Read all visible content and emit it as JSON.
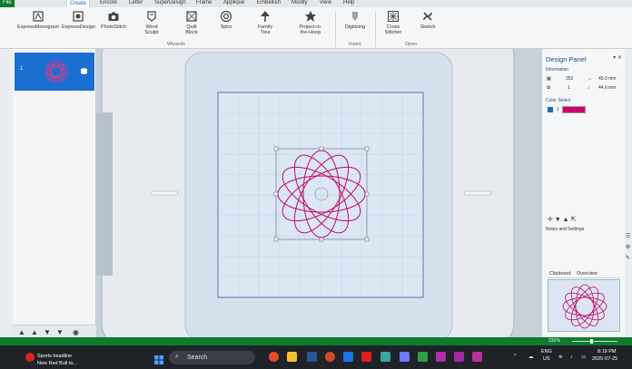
{
  "tabs": [
    "File",
    "Create",
    "Encore",
    "Letter",
    "SuperDesign",
    "Frame",
    "Appliqué",
    "Embellish",
    "Modify",
    "View",
    "Help"
  ],
  "ribbon": {
    "express_monogram": "ExpressMonogram",
    "express_design": "ExpressDesign",
    "photo_stitch": "PhotoStitch",
    "word_sculpt_1": "Word",
    "word_sculpt_2": "Sculpt",
    "quilt_block_1": "Quilt",
    "quilt_block_2": "Block",
    "spiro": "Spiro",
    "family_tree_1": "Family",
    "family_tree_2": "Tree",
    "project_hoop_1": "Project-in-",
    "project_hoop_2": "the-Hoop",
    "digitizing": "Digitizing",
    "cross_stitcher_1": "Cross",
    "cross_stitcher_2": "Stitcher",
    "sketch": "Sketch",
    "group_wizards": "Wizards",
    "group_insert": "Insert",
    "group_open": "Open"
  },
  "design_list": {
    "item_number": "1"
  },
  "design_panel": {
    "title": "Design Panel",
    "information": "Information",
    "stitch_count": "252",
    "width": "45.0 mm",
    "color_count": "1",
    "height": "44.6 mm",
    "color_select": "Color Select",
    "color_index": "1",
    "color_hex": "#d1006b",
    "notes_settings": "Notes and Settings",
    "tab_clipboard": "Clipboard",
    "tab_overview": "Overview"
  },
  "status": {
    "zoom": "231%"
  },
  "taskbar": {
    "news_title": "Sports headline",
    "news_sub": "New Red Bull to...",
    "search": "Search",
    "lang1": "ENG",
    "lang2": "US",
    "time": "8:19 PM",
    "date": "2025-07-25"
  }
}
